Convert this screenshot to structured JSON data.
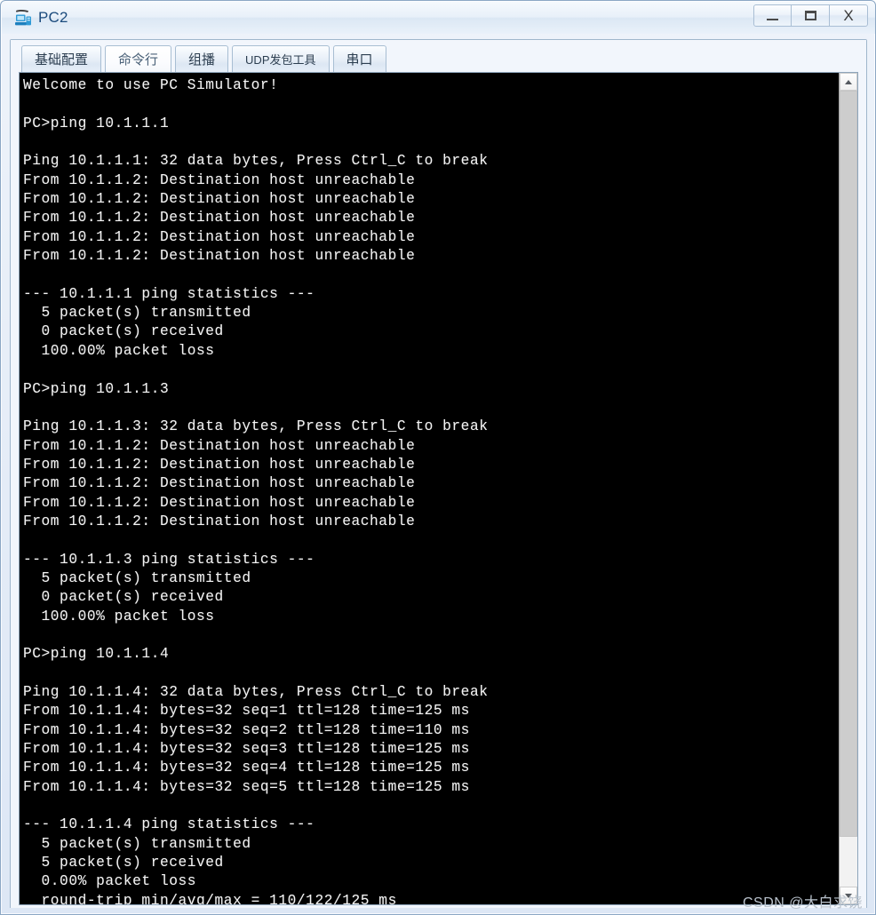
{
  "window": {
    "title": "PC2",
    "icon": "pc-simulator-icon",
    "buttons": {
      "minimize": "minimize-icon",
      "maximize": "maximize-icon",
      "close": "X"
    }
  },
  "tabs": [
    {
      "label": "基础配置",
      "active": false
    },
    {
      "label": "命令行",
      "active": true
    },
    {
      "label": "组播",
      "active": false
    },
    {
      "label": "UDP发包工具",
      "active": false
    },
    {
      "label": "串口",
      "active": false
    }
  ],
  "terminal": {
    "banner": "Welcome to use PC Simulator!",
    "text": "Welcome to use PC Simulator!\n\nPC>ping 10.1.1.1\n\nPing 10.1.1.1: 32 data bytes, Press Ctrl_C to break\nFrom 10.1.1.2: Destination host unreachable\nFrom 10.1.1.2: Destination host unreachable\nFrom 10.1.1.2: Destination host unreachable\nFrom 10.1.1.2: Destination host unreachable\nFrom 10.1.1.2: Destination host unreachable\n\n--- 10.1.1.1 ping statistics ---\n  5 packet(s) transmitted\n  0 packet(s) received\n  100.00% packet loss\n\nPC>ping 10.1.1.3\n\nPing 10.1.1.3: 32 data bytes, Press Ctrl_C to break\nFrom 10.1.1.2: Destination host unreachable\nFrom 10.1.1.2: Destination host unreachable\nFrom 10.1.1.2: Destination host unreachable\nFrom 10.1.1.2: Destination host unreachable\nFrom 10.1.1.2: Destination host unreachable\n\n--- 10.1.1.3 ping statistics ---\n  5 packet(s) transmitted\n  0 packet(s) received\n  100.00% packet loss\n\nPC>ping 10.1.1.4\n\nPing 10.1.1.4: 32 data bytes, Press Ctrl_C to break\nFrom 10.1.1.4: bytes=32 seq=1 ttl=128 time=125 ms\nFrom 10.1.1.4: bytes=32 seq=2 ttl=128 time=110 ms\nFrom 10.1.1.4: bytes=32 seq=3 ttl=128 time=125 ms\nFrom 10.1.1.4: bytes=32 seq=4 ttl=128 time=125 ms\nFrom 10.1.1.4: bytes=32 seq=5 ttl=128 time=125 ms\n\n--- 10.1.1.4 ping statistics ---\n  5 packet(s) transmitted\n  5 packet(s) received\n  0.00% packet loss\n  round-trip min/avg/max = 110/122/125 ms",
    "sessions": [
      {
        "command": "PC>ping 10.1.1.1",
        "header": "Ping 10.1.1.1: 32 data bytes, Press Ctrl_C to break",
        "replies": [
          "From 10.1.1.2: Destination host unreachable",
          "From 10.1.1.2: Destination host unreachable",
          "From 10.1.1.2: Destination host unreachable",
          "From 10.1.1.2: Destination host unreachable",
          "From 10.1.1.2: Destination host unreachable"
        ],
        "stats_title": "--- 10.1.1.1 ping statistics ---",
        "transmitted": "  5 packet(s) transmitted",
        "received": "  0 packet(s) received",
        "loss": "  100.00% packet loss",
        "rtt": ""
      },
      {
        "command": "PC>ping 10.1.1.3",
        "header": "Ping 10.1.1.3: 32 data bytes, Press Ctrl_C to break",
        "replies": [
          "From 10.1.1.2: Destination host unreachable",
          "From 10.1.1.2: Destination host unreachable",
          "From 10.1.1.2: Destination host unreachable",
          "From 10.1.1.2: Destination host unreachable",
          "From 10.1.1.2: Destination host unreachable"
        ],
        "stats_title": "--- 10.1.1.3 ping statistics ---",
        "transmitted": "  5 packet(s) transmitted",
        "received": "  0 packet(s) received",
        "loss": "  100.00% packet loss",
        "rtt": ""
      },
      {
        "command": "PC>ping 10.1.1.4",
        "header": "Ping 10.1.1.4: 32 data bytes, Press Ctrl_C to break",
        "replies": [
          "From 10.1.1.4: bytes=32 seq=1 ttl=128 time=125 ms",
          "From 10.1.1.4: bytes=32 seq=2 ttl=128 time=110 ms",
          "From 10.1.1.4: bytes=32 seq=3 ttl=128 time=125 ms",
          "From 10.1.1.4: bytes=32 seq=4 ttl=128 time=125 ms",
          "From 10.1.1.4: bytes=32 seq=5 ttl=128 time=125 ms"
        ],
        "stats_title": "--- 10.1.1.4 ping statistics ---",
        "transmitted": "  5 packet(s) transmitted",
        "received": "  5 packet(s) received",
        "loss": "  0.00% packet loss",
        "rtt": "  round-trip min/avg/max = 110/122/125 ms"
      }
    ]
  },
  "scrollbar": {
    "up_arrow": "chevron-up-icon",
    "down_arrow": "chevron-down-icon"
  },
  "watermark": "CSDN @大白求饶",
  "colors": {
    "terminal_bg": "#000000",
    "terminal_fg": "#f4f4f4",
    "window_chrome": "#e4ecf7",
    "title_text": "#1b4b7d",
    "border": "#9fb6cc"
  }
}
